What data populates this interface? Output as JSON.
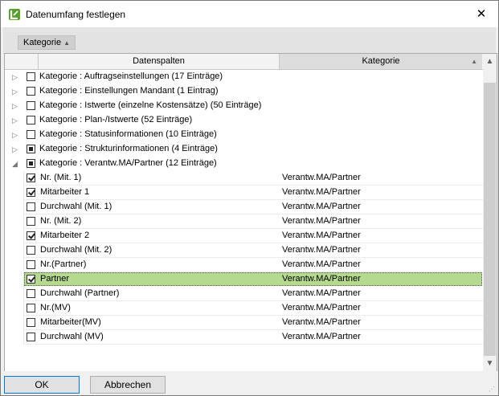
{
  "window": {
    "title": "Datenumfang festlegen",
    "close_glyph": "✕"
  },
  "groupbar": {
    "chip_label": "Kategorie",
    "chip_sort_glyph": "▲"
  },
  "grid": {
    "columns": {
      "col1": "Datenspalten",
      "col2": "Kategorie",
      "sort_glyph": "▲"
    },
    "groups": [
      {
        "label": "Kategorie : Auftragseinstellungen (17 Einträge)",
        "expanded": false,
        "state": "unchecked"
      },
      {
        "label": "Kategorie : Einstellungen Mandant (1 Eintrag)",
        "expanded": false,
        "state": "unchecked"
      },
      {
        "label": "Kategorie : Istwerte (einzelne Kostensätze) (50 Einträge)",
        "expanded": false,
        "state": "unchecked"
      },
      {
        "label": "Kategorie : Plan-/Istwerte (52 Einträge)",
        "expanded": false,
        "state": "unchecked"
      },
      {
        "label": "Kategorie : Statusinformationen (10 Einträge)",
        "expanded": false,
        "state": "unchecked"
      },
      {
        "label": "Kategorie : Strukturinformationen (4 Einträge)",
        "expanded": false,
        "state": "partial"
      },
      {
        "label": "Kategorie : Verantw.MA/Partner (12 Einträge)",
        "expanded": true,
        "state": "partial"
      }
    ],
    "items": [
      {
        "label": "Nr. (Mit. 1)",
        "category": "Verantw.MA/Partner",
        "checked": true
      },
      {
        "label": "Mitarbeiter 1",
        "category": "Verantw.MA/Partner",
        "checked": true
      },
      {
        "label": "Durchwahl (Mit. 1)",
        "category": "Verantw.MA/Partner",
        "checked": false
      },
      {
        "label": "Nr. (Mit. 2)",
        "category": "Verantw.MA/Partner",
        "checked": false
      },
      {
        "label": "Mitarbeiter 2",
        "category": "Verantw.MA/Partner",
        "checked": true
      },
      {
        "label": "Durchwahl (Mit. 2)",
        "category": "Verantw.MA/Partner",
        "checked": false
      },
      {
        "label": "Nr.(Partner)",
        "category": "Verantw.MA/Partner",
        "checked": false
      },
      {
        "label": "Partner",
        "category": "Verantw.MA/Partner",
        "checked": true,
        "selected": true
      },
      {
        "label": "Durchwahl (Partner)",
        "category": "Verantw.MA/Partner",
        "checked": false
      },
      {
        "label": "Nr.(MV)",
        "category": "Verantw.MA/Partner",
        "checked": false
      },
      {
        "label": "Mitarbeiter(MV)",
        "category": "Verantw.MA/Partner",
        "checked": false
      },
      {
        "label": "Durchwahl (MV)",
        "category": "Verantw.MA/Partner",
        "checked": false
      }
    ],
    "expander_collapsed": "▷",
    "expander_expanded": "◢",
    "selection_color": "#b4d98f"
  },
  "footer": {
    "ok_label": "OK",
    "cancel_label": "Abbrechen"
  }
}
